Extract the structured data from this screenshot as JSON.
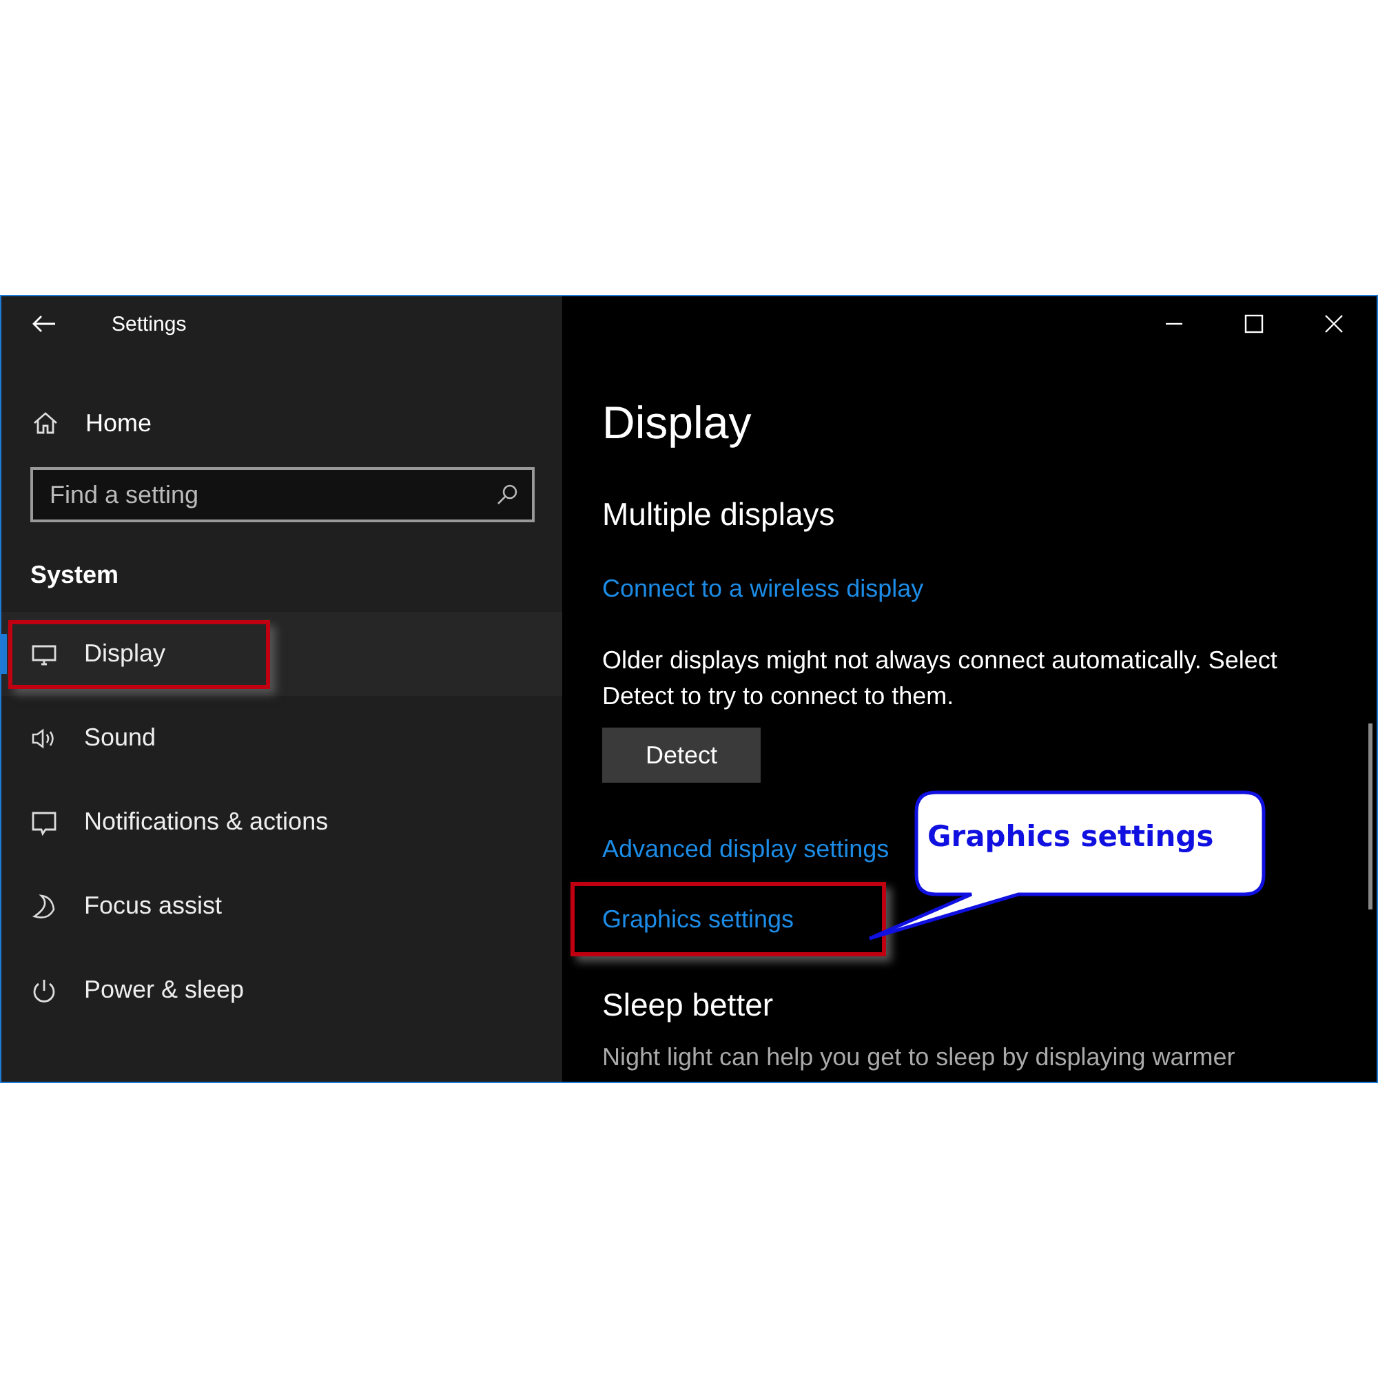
{
  "window": {
    "title": "Settings"
  },
  "sidebar": {
    "home": "Home",
    "search": {
      "placeholder": "Find a setting"
    },
    "section": "System",
    "items": [
      {
        "label": "Display",
        "kind": "monitor",
        "selected": true,
        "highlighted": true
      },
      {
        "label": "Sound",
        "kind": "speaker",
        "selected": false,
        "highlighted": false
      },
      {
        "label": "Notifications & actions",
        "kind": "message",
        "selected": false,
        "highlighted": false
      },
      {
        "label": "Focus assist",
        "kind": "moon",
        "selected": false,
        "highlighted": false
      },
      {
        "label": "Power & sleep",
        "kind": "power",
        "selected": false,
        "highlighted": false
      }
    ]
  },
  "main": {
    "title": "Display",
    "section": "Multiple displays",
    "wireless_link": "Connect to a wireless display",
    "description": "Older displays might not always connect automatically. Select Detect to try to connect to them.",
    "detect_button": "Detect",
    "links": [
      {
        "label": "Advanced display settings",
        "highlighted": false
      },
      {
        "label": "Graphics settings",
        "highlighted": true
      }
    ],
    "sleep_section": "Sleep better",
    "sleep_text": "Night light can help you get to sleep by displaying warmer"
  },
  "callout": {
    "text": "Graphics settings"
  }
}
